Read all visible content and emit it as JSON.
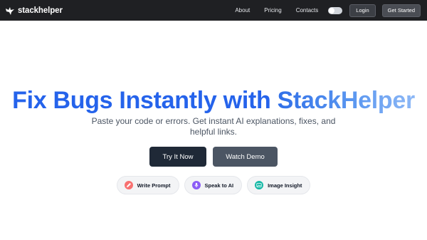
{
  "navbar": {
    "brand": "stackhelper",
    "links": [
      "About",
      "Pricing",
      "Contacts"
    ],
    "login_label": "Login",
    "get_started_label": "Get Started"
  },
  "hero": {
    "title_part1": "Fix Bugs Instantly with",
    "title_part2": "StackHelper",
    "subtitle_line1": "Paste your code or errors. Get instant AI explanations, fixes, and",
    "subtitle_line2": "helpful links.",
    "try_label": "Try It Now",
    "demo_label": "Watch Demo"
  },
  "features": [
    {
      "label": "Write Prompt",
      "icon": "pencil-icon",
      "color": "#f87171"
    },
    {
      "label": "Speak to AI",
      "icon": "microphone-icon",
      "color": "#8b5cf6"
    },
    {
      "label": "Image Insight",
      "icon": "image-icon",
      "color": "#14b8a6"
    }
  ],
  "colors": {
    "nav_bg": "#1f2023",
    "title_blue": "#2563eb",
    "title_gradient_end": "#8db8f6",
    "try_button": "#1f2937",
    "demo_button": "#4b5563"
  }
}
